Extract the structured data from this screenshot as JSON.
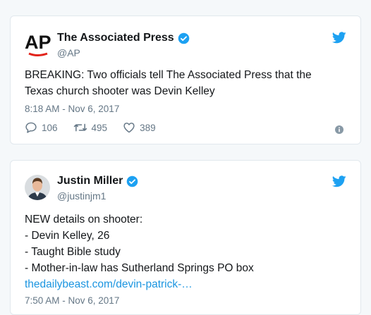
{
  "tweets": [
    {
      "name": "The Associated Press",
      "handle": "@AP",
      "avatar_icon": "ap-logo",
      "text_lines": [
        "BREAKING: Two officials tell The Associated Press that the",
        "Texas church shooter was Devin Kelley"
      ],
      "timestamp": "8:18 AM - Nov 6, 2017",
      "replies": "106",
      "retweets": "495",
      "likes": "389"
    },
    {
      "name": "Justin Miller",
      "handle": "@justinjm1",
      "avatar_icon": "user-photo-avatar",
      "text_lines": [
        "NEW details on shooter:",
        "- Devin Kelley, 26",
        "- Taught Bible study",
        "- Mother-in-law has Sutherland Springs PO box"
      ],
      "link": "thedailybeast.com/devin-patrick-…",
      "timestamp": "7:50 AM - Nov 6, 2017"
    }
  ],
  "colors": {
    "twitter_blue": "#1da1f2",
    "link": "#1b95e0",
    "ap_red": "#e2231a",
    "muted": "#657786"
  }
}
